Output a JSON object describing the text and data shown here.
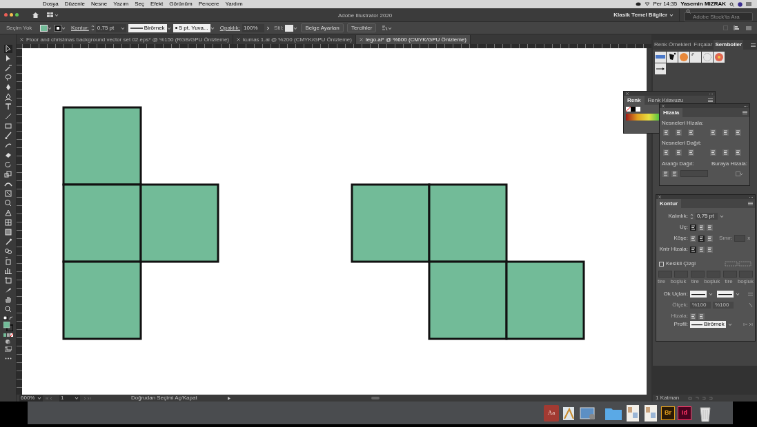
{
  "menu_bar": {
    "items": [
      "Dosya",
      "Düzenle",
      "Nesne",
      "Yazım",
      "Seç",
      "Efekt",
      "Görünüm",
      "Pencere",
      "Yardım"
    ],
    "clock": "Per 14:35",
    "user": "Yasemin MIZRAK"
  },
  "title_bar": {
    "title": "Adobe Illustrator 2020",
    "workspace": "Klasik Temel Bilgiler",
    "search": {
      "placeholder": "Adobe Stock'ta Ara"
    }
  },
  "control_bar": {
    "selection": "Seçim Yok",
    "stroke_label": "Kontur:",
    "stroke_weight": "0,75 pt",
    "stroke_profile": "Birörnek",
    "brush": "5 pt. Yuva...",
    "opacity_label": "Opaklık:",
    "opacity": "100%",
    "style_label": "Stil:",
    "buttons": [
      "Belge Ayarları",
      "Tercihler"
    ]
  },
  "tabs": [
    {
      "label": "Floor and christmas background vector set 02.eps* @ %150 (RGB/GPU Önizleme)",
      "selected": false
    },
    {
      "label": "kumas 1.ai @ %200 (CMYK/GPU Önizleme)",
      "selected": false
    },
    {
      "label": "lego.ai* @ %600 (CMYK/GPU Önizleme)",
      "selected": true
    }
  ],
  "tools": [
    {
      "selected": true
    },
    {
      "selected": false
    },
    {
      "selected": false
    },
    {
      "selected": false
    },
    {
      "selected": false
    },
    {
      "selected": false
    },
    {
      "selected": false
    },
    {
      "selected": false
    },
    {
      "selected": false
    },
    {
      "selected": false
    },
    {
      "selected": false
    },
    {
      "selected": false
    },
    {
      "selected": false
    },
    {
      "selected": false
    },
    {
      "selected": false
    },
    {
      "selected": false
    },
    {
      "selected": false
    },
    {
      "selected": false
    },
    {
      "selected": false
    },
    {
      "selected": false
    },
    {
      "selected": false
    },
    {
      "selected": false
    },
    {
      "selected": false
    },
    {
      "selected": false
    },
    {
      "selected": false
    },
    {
      "selected": false
    },
    {
      "selected": false
    },
    {
      "selected": false
    }
  ],
  "symbols_panel": {
    "tabs": [
      {
        "label": "Renk Örnekleri",
        "selected": false
      },
      {
        "label": "Fırçalar",
        "selected": false
      },
      {
        "label": "Semboller",
        "selected": true
      }
    ]
  },
  "color_panel": {
    "tabs": [
      {
        "label": "Renk",
        "selected": true
      },
      {
        "label": "Renk Kılavuzu",
        "selected": false
      }
    ]
  },
  "align_panel": {
    "title": "Hizala",
    "align_label": "Nesneleri Hizala:",
    "distribute_label": "Nesneleri Dağıt:",
    "spacing_label": "Aralığı Dağıt:",
    "align_to_label": "Buraya Hizala:"
  },
  "stroke_panel": {
    "title": "Kontur",
    "weight_label": "Kalınlık:",
    "weight": "0,75 pt",
    "cap_label": "Uç:",
    "caps": [
      {
        "selected": true
      },
      {
        "selected": false
      },
      {
        "selected": false
      }
    ],
    "corner_label": "Köşe:",
    "corners": [
      {
        "selected": false
      },
      {
        "selected": true
      },
      {
        "selected": false
      }
    ],
    "limit_label": "Sınır:",
    "limit_unit": "x",
    "align_label": "Kntr Hizala:",
    "aligns": [
      {
        "selected": true
      },
      {
        "selected": false
      },
      {
        "selected": false
      }
    ],
    "dashed": {
      "label": "Kesikli Çizgi",
      "checked": false
    },
    "dash_labels": [
      "tire",
      "boşluk",
      "tire",
      "boşluk",
      "tire",
      "boşluk"
    ],
    "arrowheads_label": "Ok Uçları:",
    "scale_label": "Ölçek:",
    "scale_values": [
      "%100",
      "%100"
    ],
    "arrow_align_label": "Hizala:",
    "profile_label": "Profil:",
    "profile": "Birörnek"
  },
  "status_bar": {
    "zoom": "600%",
    "page": "1",
    "hint": "Doğrudan Seçimi Aç/Kapat",
    "layers": "1 Katman"
  },
  "dock": [
    {
      "kind": "dictionary",
      "label": "Aa"
    },
    {
      "kind": "preview"
    },
    {
      "kind": "photos"
    },
    {
      "kind": "folder"
    },
    {
      "kind": "document"
    },
    {
      "kind": "document"
    },
    {
      "kind": "bridge",
      "label": "Br"
    },
    {
      "kind": "indesign",
      "label": "Id"
    },
    {
      "kind": "trash"
    }
  ]
}
